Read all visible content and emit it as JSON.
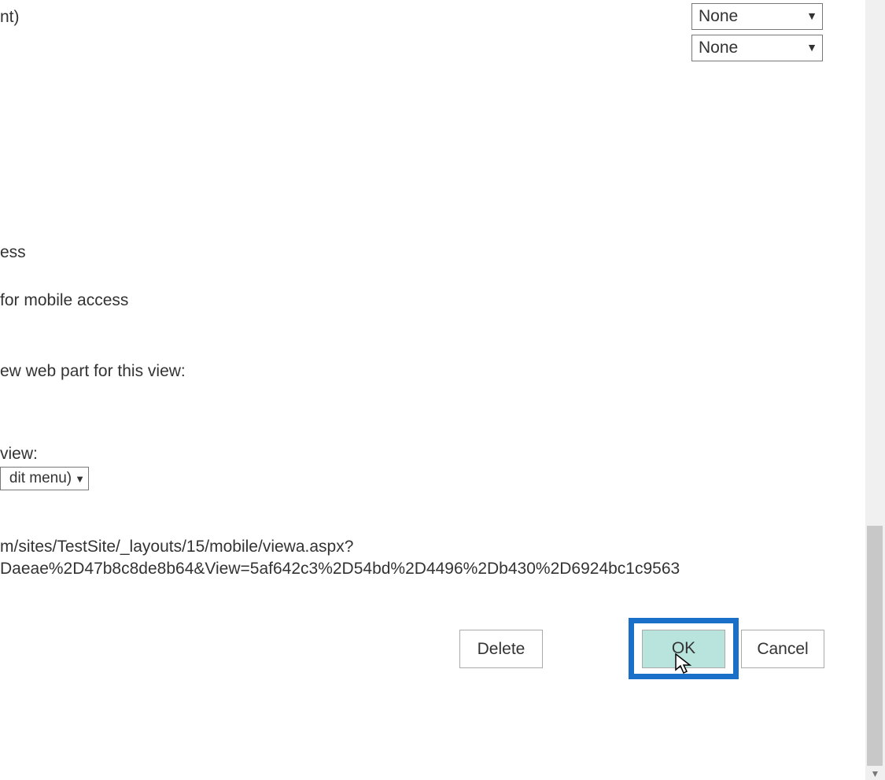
{
  "dropdowns": {
    "top1": "None",
    "top2": "None",
    "mid_visible_tail": "dit menu)"
  },
  "fragments": {
    "f1": "nt)",
    "f2": "ess",
    "f3": " for mobile access",
    "f4": "ew web part for this view:",
    "f5": "view:",
    "f6": "m/sites/TestSite/_layouts/15/mobile/viewa.aspx?",
    "f7": "Daeae%2D47b8c8de8b64&View=5af642c3%2D54bd%2D4496%2Db430%2D6924bc1c9563"
  },
  "buttons": {
    "delete": "Delete",
    "ok": "OK",
    "cancel": "Cancel"
  }
}
